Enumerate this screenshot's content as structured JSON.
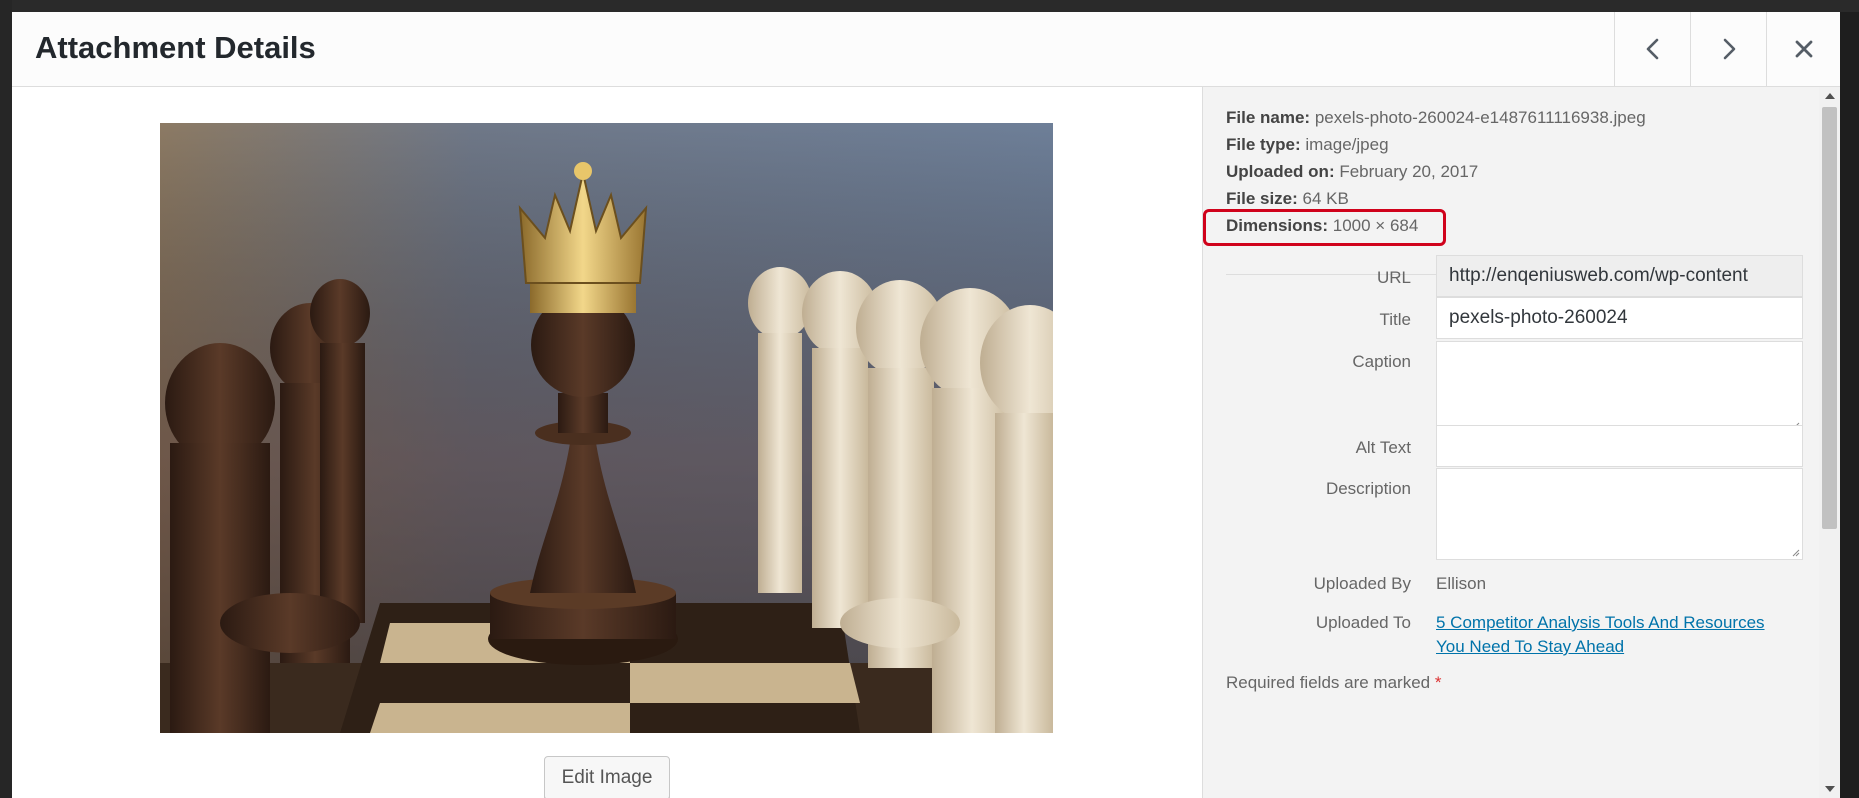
{
  "header": {
    "title": "Attachment Details",
    "prev_icon": "chevron-left-icon",
    "next_icon": "chevron-right-icon",
    "close_icon": "close-icon"
  },
  "media": {
    "image_subject": "chess pieces: dark pawn wearing a gold crown between rows of dark and light pawns on a chessboard",
    "edit_label": "Edit Image"
  },
  "meta": {
    "file_name_label": "File name:",
    "file_name": "pexels-photo-260024-e1487611116938.jpeg",
    "file_type_label": "File type:",
    "file_type": "image/jpeg",
    "uploaded_on_label": "Uploaded on:",
    "uploaded_on": "February 20, 2017",
    "file_size_label": "File size:",
    "file_size": "64 KB",
    "dimensions_label": "Dimensions:",
    "dimensions": "1000 × 684"
  },
  "fields": {
    "url_label": "URL",
    "url_value": "http://enqeniusweb.com/wp-content",
    "title_label": "Title",
    "title_value": "pexels-photo-260024",
    "caption_label": "Caption",
    "caption_value": "",
    "alt_label": "Alt Text",
    "alt_value": "",
    "description_label": "Description",
    "description_value": "",
    "uploaded_by_label": "Uploaded By",
    "uploaded_by_value": "Ellison",
    "uploaded_to_label": "Uploaded To",
    "uploaded_to_line1": "5 Competitor Analysis Tools And Resources",
    "uploaded_to_line2": "You Need To Stay Ahead"
  },
  "footer": {
    "required_text": "Required fields are marked",
    "required_star": "*"
  },
  "colors": {
    "accent_link": "#0073aa",
    "highlight": "#d0021b",
    "required_star": "#dc3232"
  }
}
